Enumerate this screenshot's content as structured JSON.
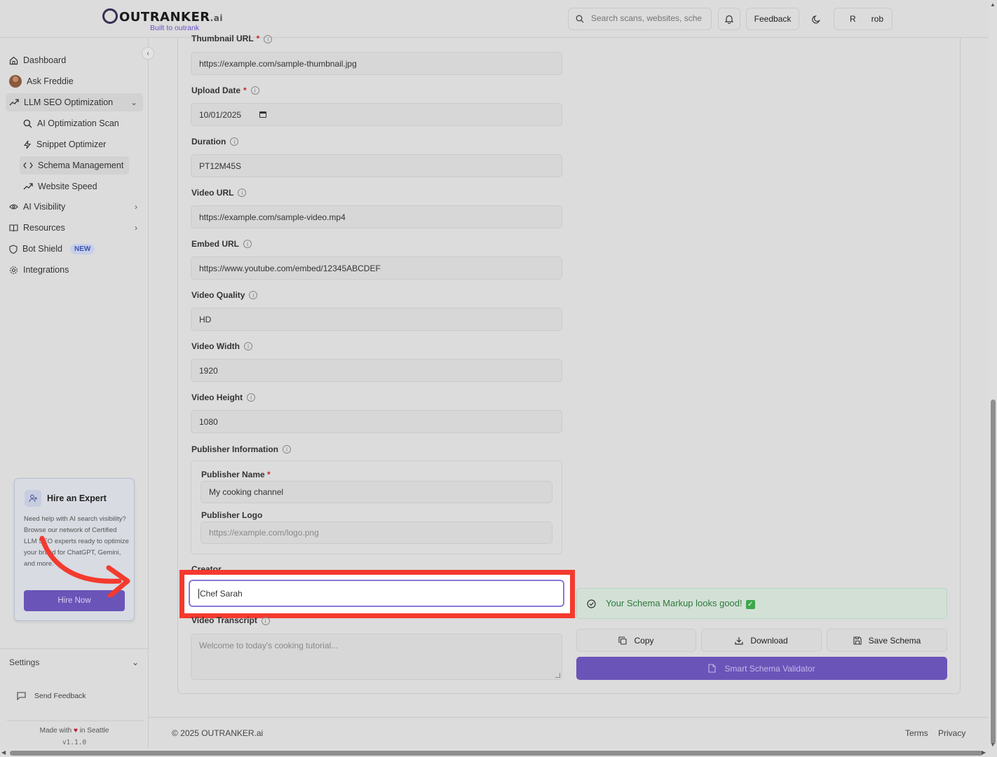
{
  "header": {
    "logo_word": "OUTRANKER",
    "logo_suffix": ".ai",
    "tagline": "Built to outrank",
    "search_placeholder": "Search scans, websites, sche",
    "feedback_label": "Feedback",
    "user_initial": "R",
    "user_name": "rob"
  },
  "sidebar": {
    "items": [
      {
        "label": "Dashboard",
        "icon": "home-icon"
      },
      {
        "label": "Ask Freddie",
        "icon": "avatar"
      },
      {
        "label": "LLM SEO Optimization",
        "icon": "trending-up-icon"
      },
      {
        "label": "AI Optimization Scan",
        "icon": "search-icon"
      },
      {
        "label": "Snippet Optimizer",
        "icon": "bolt-icon"
      },
      {
        "label": "Schema Management",
        "icon": "code-icon"
      },
      {
        "label": "Website Speed",
        "icon": "trending-up-icon"
      },
      {
        "label": "AI Visibility",
        "icon": "eye-icon"
      },
      {
        "label": "Resources",
        "icon": "book-icon"
      },
      {
        "label": "Bot Shield",
        "icon": "shield-icon",
        "badge": "NEW"
      },
      {
        "label": "Integrations",
        "icon": "gear-icon"
      }
    ],
    "hire": {
      "title": "Hire an Expert",
      "desc": "Need help with AI search visibility? Browse our network of Certified LLM SEO experts ready to optimize your brand for ChatGPT, Gemini, and more.",
      "button": "Hire Now"
    },
    "settings_label": "Settings",
    "send_feedback": "Send Feedback",
    "made_prefix": "Made with",
    "made_suffix": "in Seattle",
    "version": "v1.1.0"
  },
  "form": {
    "thumbnail_label": "Thumbnail URL",
    "thumbnail_value": "https://example.com/sample-thumbnail.jpg",
    "upload_label": "Upload Date",
    "upload_value": "10/01/2025",
    "duration_label": "Duration",
    "duration_value": "PT12M45S",
    "video_url_label": "Video URL",
    "video_url_value": "https://example.com/sample-video.mp4",
    "embed_label": "Embed URL",
    "embed_value": "https://www.youtube.com/embed/12345ABCDEF",
    "quality_label": "Video Quality",
    "quality_value": "HD",
    "width_label": "Video Width",
    "width_value": "1920",
    "height_label": "Video Height",
    "height_value": "1080",
    "publisher_label": "Publisher Information",
    "publisher_name_label": "Publisher Name",
    "publisher_name_value": "My cooking channel",
    "publisher_logo_label": "Publisher Logo",
    "publisher_logo_placeholder": "https://example.com/logo.png",
    "creator_label": "Creator",
    "creator_value": "Chef Sarah",
    "transcript_label": "Video Transcript",
    "transcript_placeholder": "Welcome to today's cooking tutorial..."
  },
  "panel": {
    "status": "Your Schema Markup looks good!",
    "copy": "Copy",
    "download": "Download",
    "save": "Save Schema",
    "validator": "Smart Schema Validator"
  },
  "footer": {
    "copyright": "© 2025 OUTRANKER.ai",
    "terms": "Terms",
    "privacy": "Privacy"
  },
  "colors": {
    "accent": "#6a54b8",
    "highlight": "#f43a2e",
    "success": "#2e7a3e"
  }
}
